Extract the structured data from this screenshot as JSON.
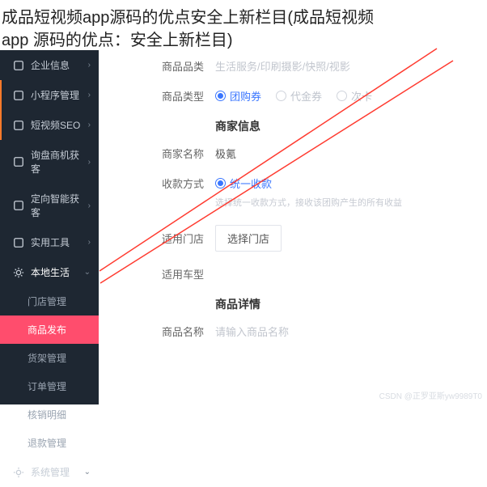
{
  "header": {
    "title_line1": "成品短视频app源码的优点安全上新栏目(成品短视频",
    "title_line2": "app 源码的优点：安全上新栏目)"
  },
  "sidebar": {
    "top_items": [
      {
        "label": "企业信息",
        "icon": "building-icon",
        "orange": false
      },
      {
        "label": "小程序管理",
        "icon": "grid-icon",
        "orange": true
      },
      {
        "label": "短视频SEO",
        "icon": "video-icon",
        "orange": true
      },
      {
        "label": "询盘商机获客",
        "icon": "magnifier-icon",
        "orange": false
      },
      {
        "label": "定向智能获客",
        "icon": "target-icon",
        "orange": false
      },
      {
        "label": "实用工具",
        "icon": "tool-icon",
        "orange": false
      }
    ],
    "active_section_label": "本地生活",
    "sub_items": [
      {
        "label": "门店管理",
        "active": false
      },
      {
        "label": "商品发布",
        "active": true
      },
      {
        "label": "货架管理",
        "active": false
      },
      {
        "label": "订单管理",
        "active": false
      },
      {
        "label": "核销明细",
        "active": false
      },
      {
        "label": "退款管理",
        "active": false
      }
    ],
    "bottom_item": {
      "label": "系统管理",
      "icon": "gear-icon"
    }
  },
  "form": {
    "product_category_label": "商品品类",
    "product_category_value": "生活服务/印刷摄影/快照/视影",
    "product_type_label": "商品类型",
    "product_type_options": [
      {
        "label": "团购券",
        "checked": true
      },
      {
        "label": "代金券",
        "checked": false
      },
      {
        "label": "次卡",
        "checked": false
      }
    ],
    "merchant_section": "商家信息",
    "merchant_name_label": "商家名称",
    "merchant_name_value": "极氪",
    "payment_label": "收款方式",
    "payment_options": [
      {
        "label": "统一收款",
        "checked": true
      }
    ],
    "payment_note": "选择统一收款方式，接收该团购产生的所有收益",
    "store_label": "适用门店",
    "store_button": "选择门店",
    "car_type_label": "适用车型",
    "detail_section": "商品详情",
    "product_name_label": "商品名称",
    "product_name_placeholder": "请输入商品名称"
  },
  "watermark": "CSDN @正罗亚斯yw9989T0"
}
